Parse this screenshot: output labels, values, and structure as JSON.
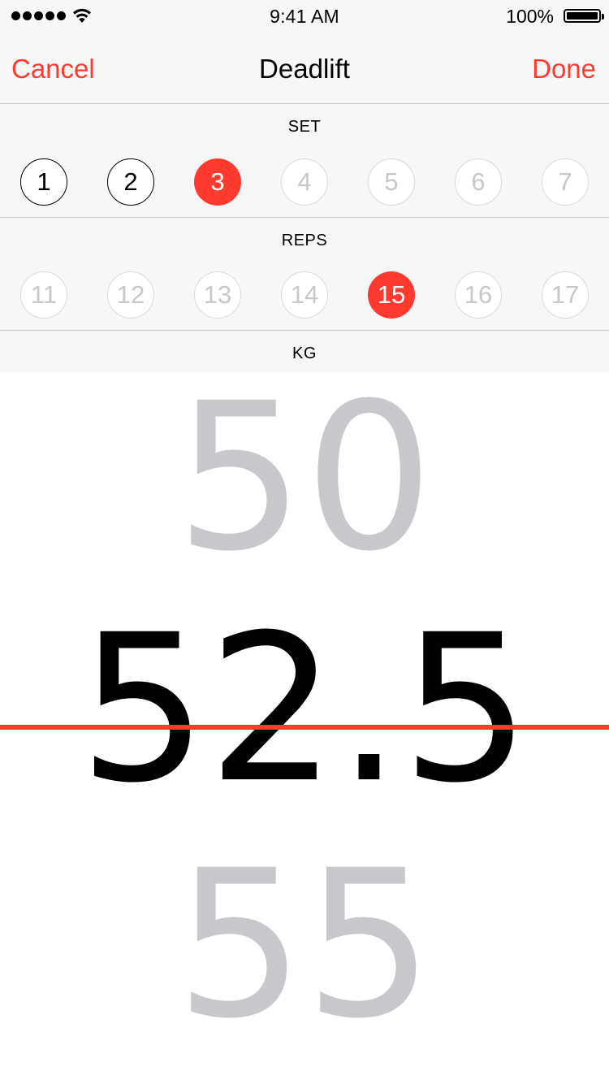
{
  "status_bar": {
    "time": "9:41 AM",
    "battery_percent": "100%",
    "signal_bars": 5,
    "wifi_icon": "wifi-icon",
    "battery_icon": "battery-full-icon"
  },
  "nav": {
    "cancel_label": "Cancel",
    "title": "Deadlift",
    "done_label": "Done"
  },
  "colors": {
    "accent": "#ff3b30",
    "inactive": "#c7c7cc",
    "background_top": "#f7f7f7"
  },
  "set_section": {
    "header": "SET",
    "options": [
      {
        "label": "1",
        "state": "done"
      },
      {
        "label": "2",
        "state": "done"
      },
      {
        "label": "3",
        "state": "active"
      },
      {
        "label": "4",
        "state": "inactive"
      },
      {
        "label": "5",
        "state": "inactive"
      },
      {
        "label": "6",
        "state": "inactive"
      },
      {
        "label": "7",
        "state": "inactive"
      }
    ]
  },
  "reps_section": {
    "header": "REPS",
    "options": [
      {
        "label": "11",
        "state": "inactive"
      },
      {
        "label": "12",
        "state": "inactive"
      },
      {
        "label": "13",
        "state": "inactive"
      },
      {
        "label": "14",
        "state": "inactive"
      },
      {
        "label": "15",
        "state": "active"
      },
      {
        "label": "16",
        "state": "inactive"
      },
      {
        "label": "17",
        "state": "inactive"
      }
    ]
  },
  "kg_section": {
    "header": "KG",
    "previous_value": "50",
    "selected_value": "52.5",
    "next_value": "55"
  }
}
